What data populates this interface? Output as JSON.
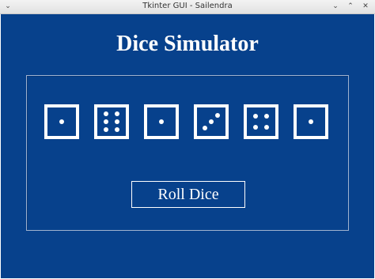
{
  "window": {
    "title": "Tkinter GUI - Sailendra",
    "menu_glyph": "⌄",
    "minimize_glyph": "⌄",
    "maximize_glyph": "⌃",
    "close_glyph": "✕"
  },
  "app": {
    "heading": "Dice Simulator",
    "background_color": "#07418c",
    "foreground_color": "#ffffff"
  },
  "dice": [
    {
      "value": 1
    },
    {
      "value": 6
    },
    {
      "value": 1
    },
    {
      "value": 3
    },
    {
      "value": 4
    },
    {
      "value": 1
    }
  ],
  "roll_button": {
    "label": "Roll Dice"
  }
}
